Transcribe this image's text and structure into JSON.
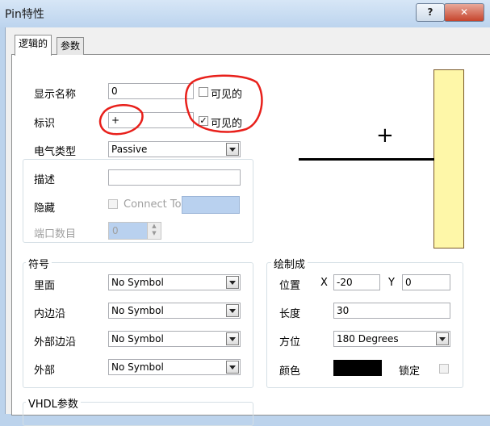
{
  "window": {
    "title": "Pin特性",
    "help_glyph": "?",
    "close_glyph": "✕"
  },
  "tabs": [
    {
      "label": "逻辑的"
    },
    {
      "label": "参数"
    }
  ],
  "form": {
    "display_name": {
      "label": "显示名称",
      "value": "0",
      "visible_label": "可见的",
      "visible_checked": false
    },
    "designator": {
      "label": "标识",
      "value": "+",
      "visible_label": "可见的",
      "visible_checked": true
    },
    "electrical_type": {
      "label": "电气类型",
      "value": "Passive"
    },
    "description": {
      "label": "描述",
      "value": ""
    },
    "hide": {
      "label": "隐藏",
      "connect_to_label": "Connect To",
      "connect_value": ""
    },
    "port_count": {
      "label": "端口数目",
      "value": "0"
    }
  },
  "symbol_group": {
    "title": "符号",
    "rows": [
      {
        "label": "里面",
        "value": "No Symbol"
      },
      {
        "label": "内边沿",
        "value": "No Symbol"
      },
      {
        "label": "外部边沿",
        "value": "No Symbol"
      },
      {
        "label": "外部",
        "value": "No Symbol"
      }
    ]
  },
  "graphics_group": {
    "title": "绘制成",
    "position_label": "位置",
    "x_label": "X",
    "x_value": "-20",
    "y_label": "Y",
    "y_value": "0",
    "length_label": "长度",
    "length_value": "30",
    "orientation_label": "方位",
    "orientation_value": "180 Degrees",
    "color_label": "颜色",
    "color_value": "#000000",
    "locked_label": "锁定"
  },
  "vhdl_group": {
    "title": "VHDL参数"
  },
  "preview": {
    "body_color": "#fef7a8",
    "pin_label": "+"
  },
  "annotation_color": "#e8201b"
}
